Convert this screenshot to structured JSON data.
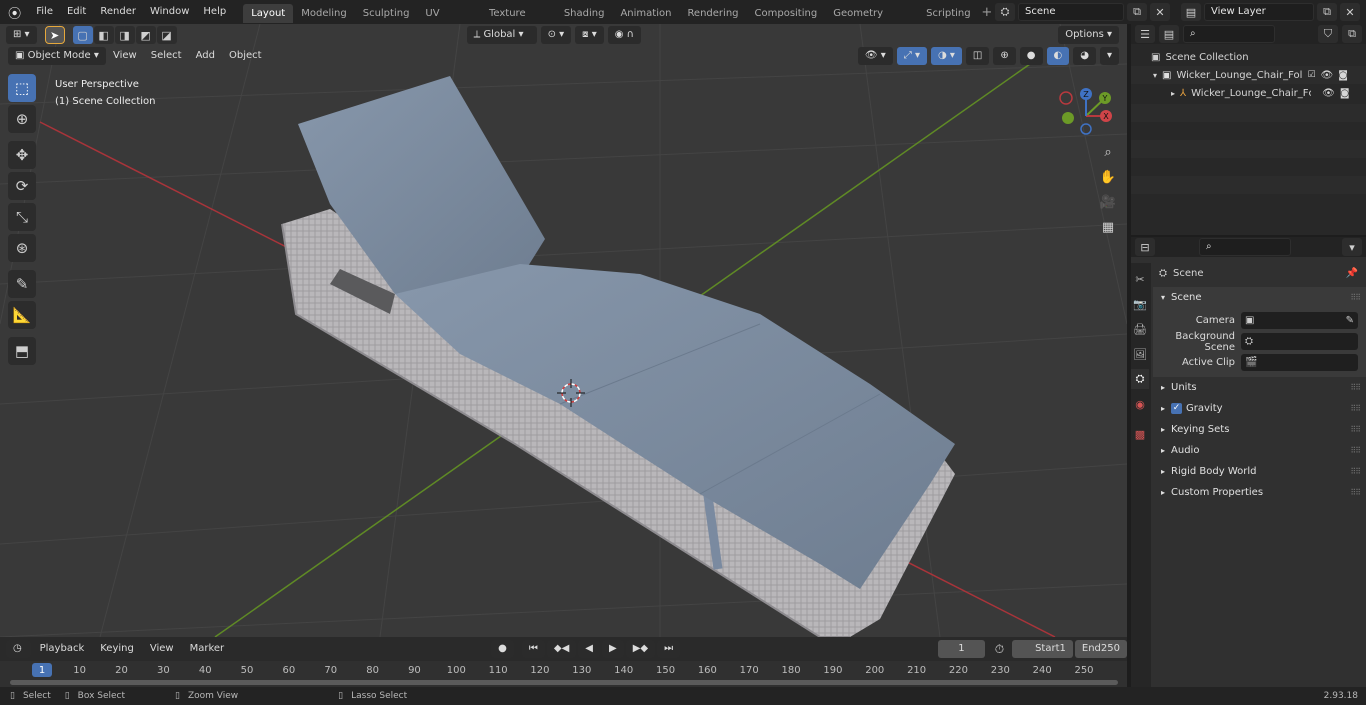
{
  "menus": [
    "File",
    "Edit",
    "Render",
    "Window",
    "Help"
  ],
  "workspaces": [
    "Layout",
    "Modeling",
    "Sculpting",
    "UV Editing",
    "Texture Paint",
    "Shading",
    "Animation",
    "Rendering",
    "Compositing",
    "Geometry Nodes",
    "Scripting"
  ],
  "active_workspace": "Layout",
  "scene_name": "Scene",
  "view_layer": "View Layer",
  "viewport": {
    "mode": "Object Mode",
    "menu_view": "View",
    "menu_select": "Select",
    "menu_add": "Add",
    "menu_object": "Object",
    "transform_orientation": "Global",
    "options_label": "Options",
    "overlay_line1": "User Perspective",
    "overlay_line2": "(1) Scene Collection"
  },
  "outliner": {
    "root": "Scene Collection",
    "collection": "Wicker_Lounge_Chair_Folding",
    "object": "Wicker_Lounge_Chair_Fc"
  },
  "properties": {
    "context_label": "Scene",
    "panel_title": "Scene",
    "camera_label": "Camera",
    "background_scene_label": "Background Scene",
    "active_clip_label": "Active Clip",
    "subpanels": [
      "Units",
      "Gravity",
      "Keying Sets",
      "Audio",
      "Rigid Body World",
      "Custom Properties"
    ]
  },
  "timeline": {
    "playback": "Playback",
    "keying": "Keying",
    "view": "View",
    "marker": "Marker",
    "current_frame": "1",
    "start_label": "Start",
    "start_value": "1",
    "end_label": "End",
    "end_value": "250",
    "ruler": [
      "1",
      "10",
      "20",
      "30",
      "40",
      "50",
      "60",
      "70",
      "80",
      "90",
      "100",
      "110",
      "120",
      "130",
      "140",
      "150",
      "160",
      "170",
      "180",
      "190",
      "200",
      "210",
      "220",
      "230",
      "240",
      "250"
    ]
  },
  "status": {
    "select": "Select",
    "box_select": "Box Select",
    "zoom_view": "Zoom View",
    "lasso_select": "Lasso Select",
    "version": "2.93.18"
  },
  "colors": {
    "accent": "#4772b3",
    "axis_x": "#b8393e",
    "axis_y": "#6c9a27",
    "cushion": "#7f8ea1",
    "wicker": "#b8b6b8"
  }
}
